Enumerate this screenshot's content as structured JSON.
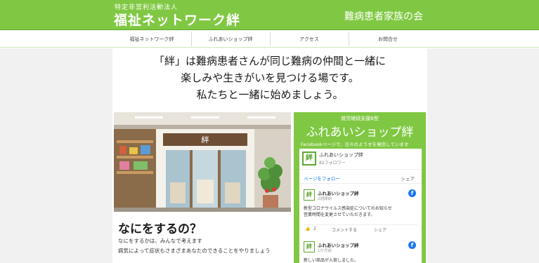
{
  "header": {
    "org_type": "特定非営利活動法人",
    "org_name": "福祉ネットワーク絆",
    "sub_name": "難病患者家族の会"
  },
  "nav": {
    "items": [
      {
        "label": "福祉ネットワーク絆"
      },
      {
        "label": "ふれあいショップ絆"
      },
      {
        "label": "アクセス"
      },
      {
        "label": "お問合せ"
      }
    ]
  },
  "main": {
    "tagline_1": "「絆」は難病患者さんが同じ難病の仲間と一緒に",
    "tagline_2": "楽しみや生きがいを見つける場です。",
    "tagline_3": "私たちと一緒に始めましょう。",
    "what_title": "なにをするの？",
    "what_text_1": "なにをするかは、みんなで考えます",
    "what_text_2": "病気によって症状もさまざまあなたのできることをやりましょう"
  },
  "photo": {
    "sign_text": "絆"
  },
  "shop": {
    "subtitle": "就労継続支援B型",
    "title": "ふれあいショップ絆",
    "note": "Facebookページで、日々のようすを発信しています",
    "facebook": {
      "logo_char": "絆",
      "page_name": "ふれあいショップ絆",
      "followers": "82フォロワー",
      "tab_timeline": "ページをフォロー",
      "tab_share": "シェア",
      "posts": [
        {
          "avatar": "絆",
          "name": "ふれあいショップ絆",
          "time": "2週間前",
          "text_1": "新型コロナウイルス感染症についてのお知らせ",
          "text_2": "営業時間を変更させていただきます。",
          "likes": "2",
          "comment": "コメントする",
          "share": "シェア"
        },
        {
          "avatar": "絆",
          "name": "ふれあいショップ絆",
          "time": "1か月前",
          "text_1": "新しい商品が入荷しました。"
        }
      ]
    }
  },
  "colors": {
    "brand_green": "#80c843",
    "facebook_blue": "#1877f2"
  }
}
